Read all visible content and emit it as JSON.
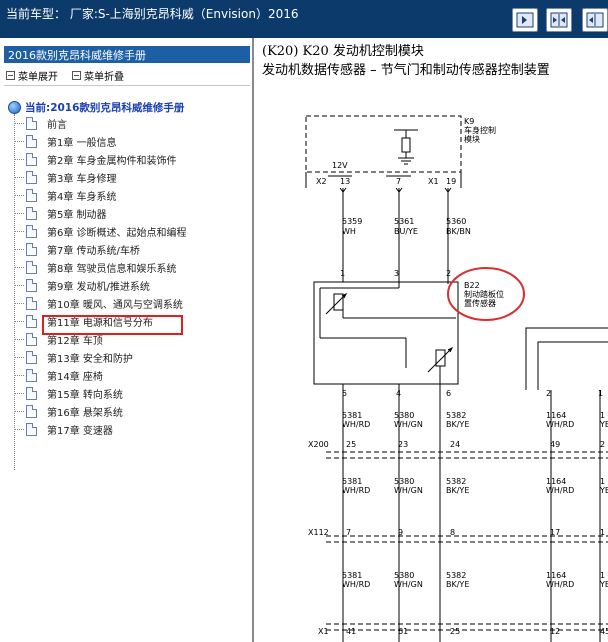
{
  "header": {
    "title": "当前车型：  厂家:S-上海别克昂科威（Envision）2016",
    "buttons": [
      {
        "icon": "forward-arrow-icon"
      },
      {
        "icon": "collapse-panels-icon"
      },
      {
        "icon": "expand-panels-icon"
      }
    ]
  },
  "sidebar": {
    "manual_title": "2016款别克昂科威维修手册",
    "expand_label": "菜单展开",
    "collapse_label": "菜单折叠",
    "current_label": "当前:2016款别克昂科威维修手册",
    "items": [
      {
        "label": "前言"
      },
      {
        "label": "第1章 一般信息"
      },
      {
        "label": "第2章 车身金属构件和装饰件"
      },
      {
        "label": "第3章 车身修理"
      },
      {
        "label": "第4章 车身系统"
      },
      {
        "label": "第5章 制动器"
      },
      {
        "label": "第6章 诊断概述、起始点和编程"
      },
      {
        "label": "第7章 传动系统/车桥"
      },
      {
        "label": "第8章 驾驶员信息和娱乐系统"
      },
      {
        "label": "第9章 发动机/推进系统"
      },
      {
        "label": "第10章 暖风、通风与空调系统"
      },
      {
        "label": "第11章 电源和信号分布"
      },
      {
        "label": "第12章 车顶"
      },
      {
        "label": "第13章 安全和防护"
      },
      {
        "label": "第14章 座椅"
      },
      {
        "label": "第15章 转向系统"
      },
      {
        "label": "第16章 悬架系统"
      },
      {
        "label": "第17章 变速器"
      }
    ],
    "selected_index": 9
  },
  "content": {
    "heading1": "(K20) K20 发动机控制模块",
    "heading2": "发动机数据传感器 – 节气门和制动传感器控制装置",
    "diagram": {
      "k9_id": "K9",
      "k9_name_line1": "车身控制",
      "k9_name_line2": "模块",
      "voltage": "12V",
      "conn_x2": "X2",
      "conn_x1": "X1",
      "pin_13": "13",
      "pin_7": "7",
      "pin_19": "19",
      "w1_id": "5359",
      "w1_col": "WH",
      "w2_id": "5361",
      "w2_col": "BU/YE",
      "w3_id": "5360",
      "w3_col": "BK/BN",
      "s_pin1": "1",
      "s_pin3": "3",
      "s_pin2": "2",
      "b22_id": "B22",
      "b22_line1": "制动踏板位",
      "b22_line2": "置传感器",
      "p5": "5",
      "p4": "4",
      "p6": "6",
      "p2": "2",
      "p1": "1",
      "w4_id": "5381",
      "w4_col": "WH/RD",
      "w5_id": "5380",
      "w5_col": "WH/GN",
      "w6_id": "5382",
      "w6_col": "BK/YE",
      "w7_id": "1164",
      "w7_col": "WH/RD",
      "w8_id": "1",
      "w8_col": "YE",
      "x200": "X200",
      "x200_p1": "25",
      "x200_p2": "23",
      "x200_p3": "24",
      "x200_p4": "49",
      "x200_p5": "2",
      "x112": "X112",
      "x112_p1": "7",
      "x112_p2": "9",
      "x112_p3": "8",
      "x112_p4": "17",
      "x112_p5": "1",
      "x1b": "X1",
      "x1b_p1": "41",
      "x1b_p2": "61",
      "x1b_p3": "25",
      "x1b_p4": "12",
      "x1b_p5": "45"
    }
  }
}
